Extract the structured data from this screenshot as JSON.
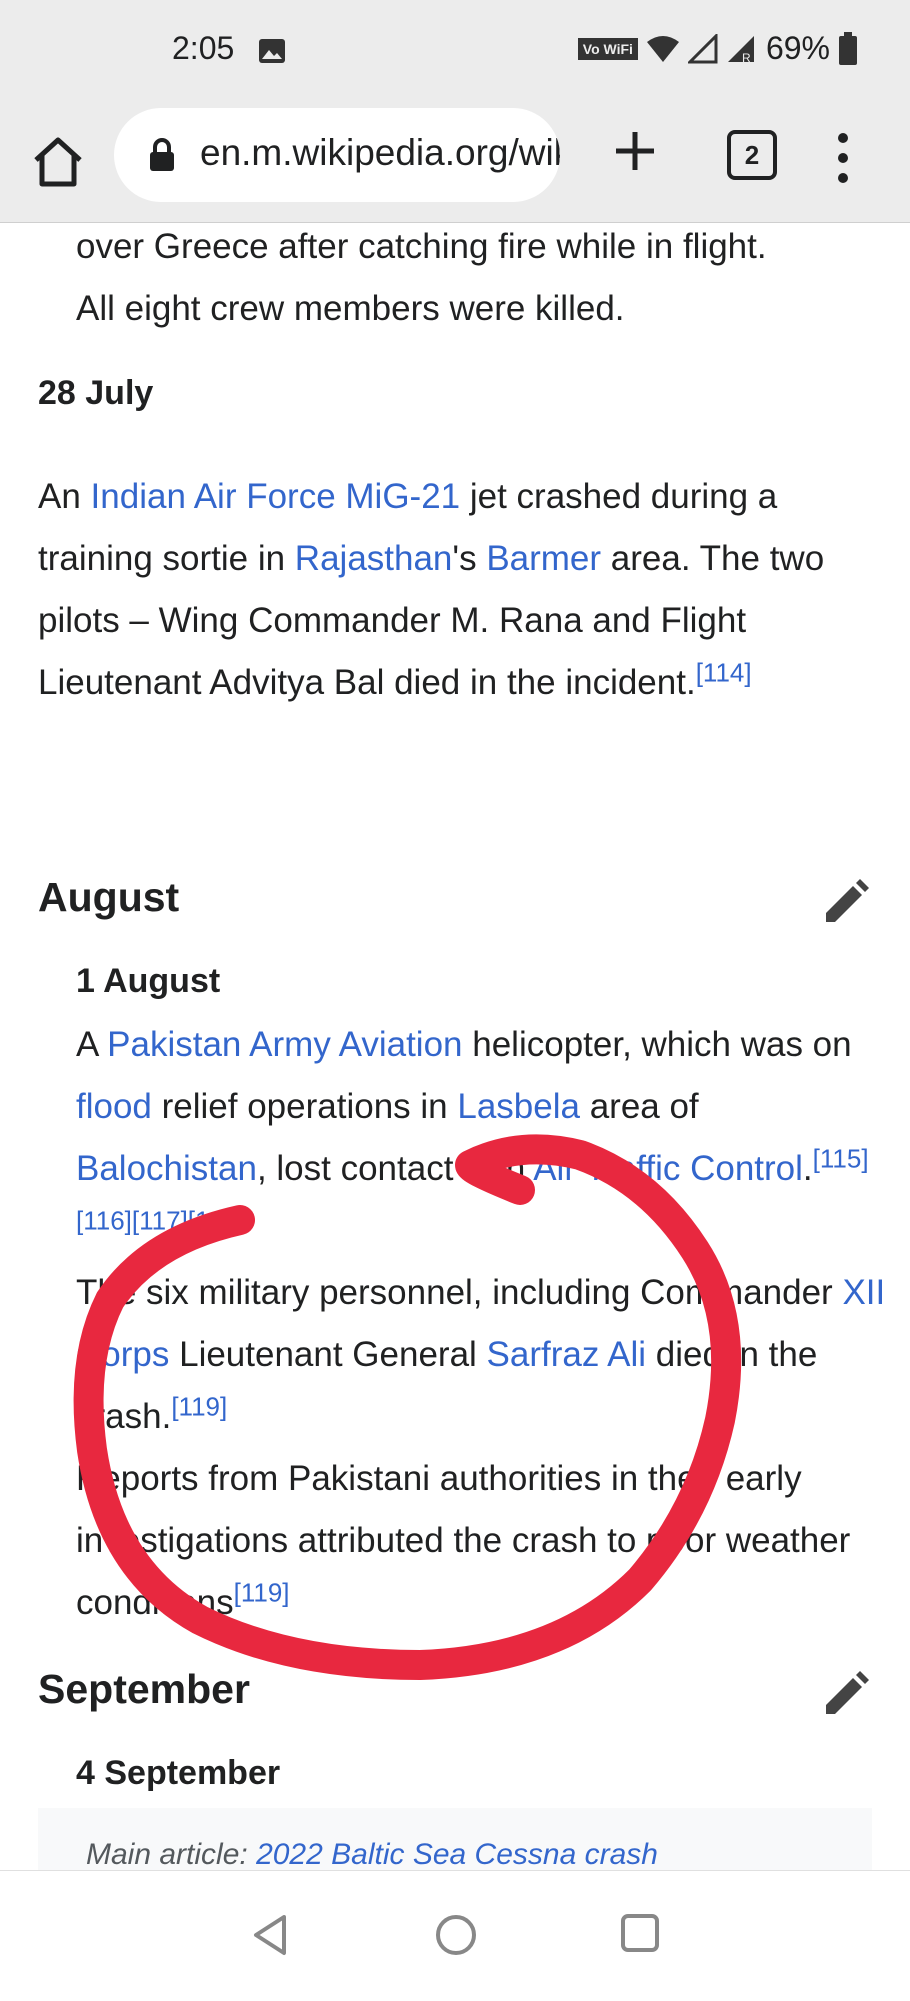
{
  "status_bar": {
    "time": "2:05",
    "volte_label": "Vo WiFi",
    "battery": "69%",
    "icons": [
      "image-icon",
      "wifi-icon",
      "signal-icon",
      "roaming-signal-icon",
      "battery-icon"
    ]
  },
  "browser": {
    "url": "en.m.wikipedia.org/wiki",
    "tab_count": "2",
    "icons": [
      "home-icon",
      "lock-icon",
      "plus-icon",
      "menu-icon"
    ]
  },
  "article": {
    "top_para": {
      "line1": "over Greece after catching fire while in flight.",
      "line2": "All eight crew members were killed."
    },
    "july28": {
      "date": "28 July",
      "t1": "An ",
      "link1": "Indian Air Force MiG-21",
      "t2": " jet crashed during a training sortie in ",
      "link2": "Rajasthan",
      "t3": "'s ",
      "link3": "Barmer",
      "t4": " area. The two pilots – Wing Commander M. Rana and Flight Lieutenant Advitya Bal died in the incident.",
      "ref": "[114]"
    },
    "august": {
      "heading": "August",
      "date": "1 August",
      "t1": "A ",
      "link1": "Pakistan Army Aviation",
      "t2": " helicopter, which was on ",
      "link2": "flood",
      "t3": " relief operations in ",
      "link3": "Lasbela",
      "t4": " area of ",
      "link4": "Balochistan",
      "t5": ", lost contact with ",
      "link5": "Air Traffic Control",
      "t6": ".",
      "refs1": "[115][116][117][118]",
      "p2_t1": "The six military personnel, including Commander ",
      "p2_link1": "XII Corps",
      "p2_t2": " Lieutenant General ",
      "p2_link2": "Sarfraz Ali",
      "p2_t3": " died in the crash.",
      "p2_ref": "[119]",
      "p3_t1": "Reports from Pakistani authorities in their early investigations attributed the crash to poor weather conditions",
      "p3_ref": "[119]"
    },
    "september": {
      "heading": "September",
      "date": "4 September",
      "main_prefix": "Main article: ",
      "main_link": "2022 Baltic Sea Cessna crash"
    }
  },
  "annotation_color": "#e8283f"
}
